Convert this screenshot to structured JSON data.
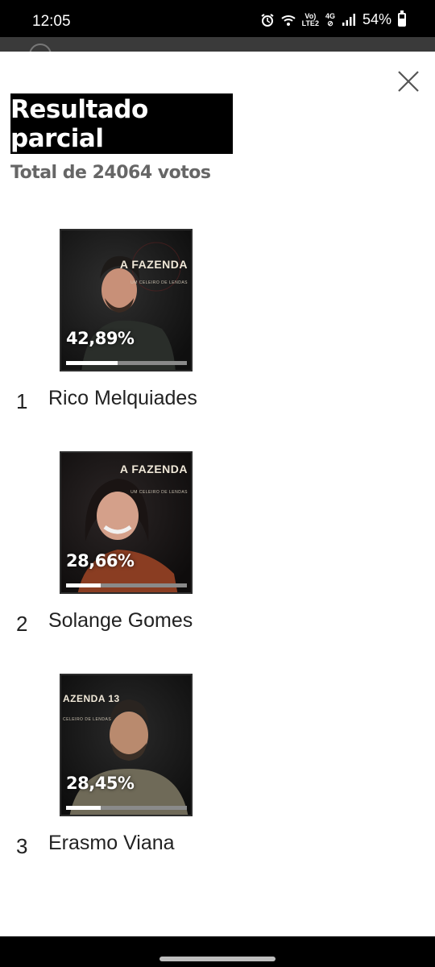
{
  "status_bar": {
    "time": "12:05",
    "icons": [
      "alarm-icon",
      "wifi-icon",
      "volte-lte-icon",
      "4g-icon",
      "signal-icon",
      "battery-icon"
    ],
    "volte_label": "Vo)",
    "lte_label": "LTE2",
    "network_label": "4G",
    "battery_percent": "54%"
  },
  "modal": {
    "close_icon": "close-icon",
    "title": "Resultado parcial",
    "total_votes": "Total de 24064 votos",
    "candidates": [
      {
        "rank": "1",
        "name": "Rico Melquiades",
        "percent": "42,89%",
        "share": 0.4289,
        "brand": "A FAZENDA",
        "brand_sub": "UM CELEIRO DE LENDAS"
      },
      {
        "rank": "2",
        "name": "Solange Gomes",
        "percent": "28,66%",
        "share": 0.2866,
        "brand": "A FAZENDA",
        "brand_sub": "UM CELEIRO DE LENDAS"
      },
      {
        "rank": "3",
        "name": "Erasmo Viana",
        "percent": "28,45%",
        "share": 0.2845,
        "brand": "AZENDA 13",
        "brand_sub": "CELEIRO DE LENDAS"
      }
    ]
  },
  "colors": {
    "title_bg": "#000000",
    "title_text": "#ffffff",
    "subtitle_text": "#666666",
    "bar_fill": "#ffffff",
    "bar_track": "#8a8a8a"
  }
}
